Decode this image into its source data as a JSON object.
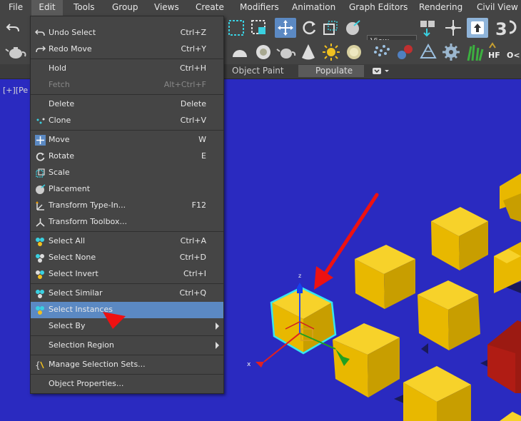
{
  "menubar": {
    "items": [
      "File",
      "Edit",
      "Tools",
      "Group",
      "Views",
      "Create",
      "Modifiers",
      "Animation",
      "Graph Editors",
      "Rendering",
      "Civil View"
    ],
    "active": "Edit"
  },
  "toolbar": {
    "view_dropdown": "View"
  },
  "ribbon": {
    "object_paint": "Object Paint",
    "populate": "Populate"
  },
  "viewport": {
    "label": "[+][Pe"
  },
  "edit_menu": {
    "items": [
      {
        "label": "Undo Select",
        "shortcut": "Ctrl+Z",
        "icon": "undo-icon"
      },
      {
        "label": "Redo Move",
        "shortcut": "Ctrl+Y",
        "icon": "redo-icon"
      },
      {
        "label": "Hold",
        "shortcut": "Ctrl+H",
        "icon": ""
      },
      {
        "label": "Fetch",
        "shortcut": "Alt+Ctrl+F",
        "icon": "",
        "disabled": true
      },
      {
        "label": "Delete",
        "shortcut": "Delete",
        "icon": ""
      },
      {
        "label": "Clone",
        "shortcut": "Ctrl+V",
        "icon": "clone-icon"
      },
      {
        "label": "Move",
        "shortcut": "W",
        "icon": "move-icon"
      },
      {
        "label": "Rotate",
        "shortcut": "E",
        "icon": "rotate-icon"
      },
      {
        "label": "Scale",
        "shortcut": "",
        "icon": "scale-icon"
      },
      {
        "label": "Placement",
        "shortcut": "",
        "icon": "placement-icon"
      },
      {
        "label": "Transform Type-In...",
        "shortcut": "F12",
        "icon": "transform-type-in-icon"
      },
      {
        "label": "Transform Toolbox...",
        "shortcut": "",
        "icon": "transform-toolbox-icon"
      },
      {
        "label": "Select All",
        "shortcut": "Ctrl+A",
        "icon": "select-all-icon"
      },
      {
        "label": "Select None",
        "shortcut": "Ctrl+D",
        "icon": "select-none-icon"
      },
      {
        "label": "Select Invert",
        "shortcut": "Ctrl+I",
        "icon": "select-invert-icon"
      },
      {
        "label": "Select Similar",
        "shortcut": "Ctrl+Q",
        "icon": "select-similar-icon"
      },
      {
        "label": "Select Instances",
        "shortcut": "",
        "icon": "select-instances-icon",
        "highlighted": true
      },
      {
        "label": "Select By",
        "shortcut": "",
        "icon": "",
        "submenu": true
      },
      {
        "label": "Selection Region",
        "shortcut": "",
        "icon": "",
        "submenu": true
      },
      {
        "label": "Manage Selection Sets...",
        "shortcut": "",
        "icon": "selection-sets-icon"
      },
      {
        "label": "Object Properties...",
        "shortcut": "",
        "icon": ""
      }
    ]
  },
  "gizmo": {
    "x_axis": "x",
    "z_axis": "z"
  },
  "colors": {
    "viewport_bg": "#2a2ac0",
    "highlight": "#5b89c3",
    "cube_yellow": "#f2c500",
    "cube_red": "#b01c14",
    "arrow_red": "#ee1111"
  }
}
